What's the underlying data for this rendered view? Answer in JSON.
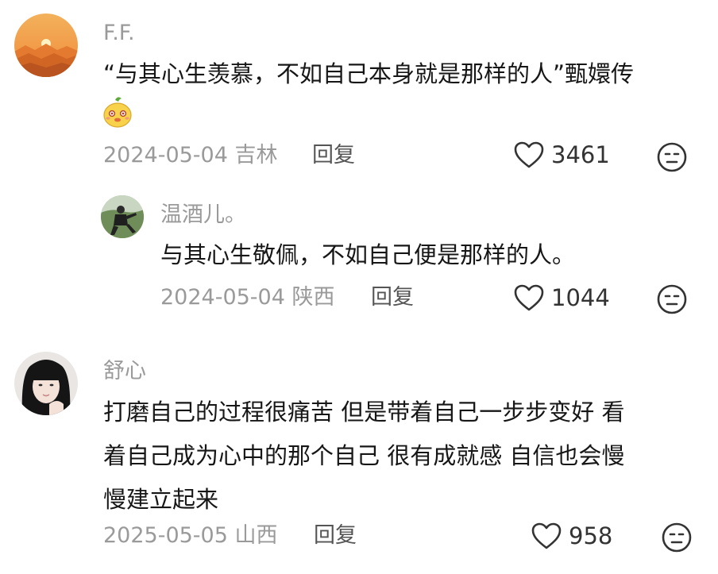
{
  "comments": [
    {
      "username": "F.F.",
      "lines": [
        "“与其心生羡慕，不如自己本身就是那样的人”甄嬛传"
      ],
      "sticker_icon": "mascot-emoji-icon",
      "date_location": "2024-05-04 吉林",
      "reply_label": "回复",
      "likes": "3461"
    },
    {
      "username": "温酒儿。",
      "lines": [
        "与其心生敬佩，不如自己便是那样的人。"
      ],
      "date_location": "2024-05-04 陕西",
      "reply_label": "回复",
      "likes": "1044"
    },
    {
      "username": "舒心",
      "lines": [
        "打磨自己的过程很痛苦 但是带着自己一步步变好 看",
        "着自己成为心中的那个自己 很有成就感 自信也会慢",
        "慢建立起来"
      ],
      "date_location": "2025-05-05 山西",
      "reply_label": "回复",
      "likes": "958"
    }
  ],
  "icons": {
    "like": "heart-icon",
    "dislike": "neutral-face-icon"
  },
  "colors": {
    "username": "#9a9a9a",
    "meta": "#9a9a9a",
    "text": "#161616",
    "icon": "#333333"
  }
}
